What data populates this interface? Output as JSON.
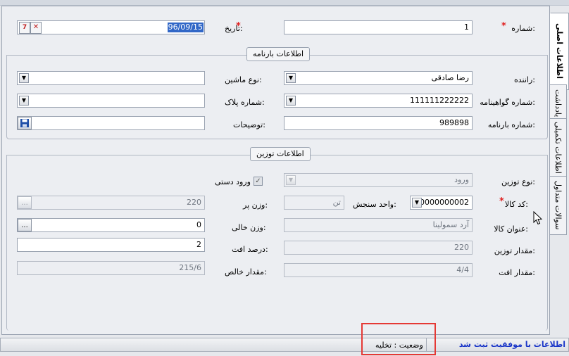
{
  "tabs": [
    {
      "label": "اطلاعات اصلی",
      "active": true
    },
    {
      "label": "یادداشت",
      "active": false
    },
    {
      "label": "اطلاعات تکمیلی",
      "active": false
    },
    {
      "label": "سوالات متداول",
      "active": false
    }
  ],
  "header": {
    "number_label": "شماره:",
    "number_value": "1",
    "date_label": "تاریخ:",
    "date_value": "96/09/15"
  },
  "waybill": {
    "title": "اطلاعات بارنامه",
    "driver_label": "راننده:",
    "driver_value": "رضا صادقی",
    "machine_type_label": "نوع ماشین:",
    "machine_type_value": "",
    "license_label": "شماره گواهینامه:",
    "license_value": "111111222222",
    "plate_label": "شماره پلاک:",
    "plate_value": "",
    "waybill_no_label": "شماره بارنامه:",
    "waybill_no_value": "989898",
    "description_label": "توضیحات:",
    "description_value": ""
  },
  "weighing": {
    "title": "اطلاعات توزین",
    "weigh_type_label": "نوع توزین:",
    "weigh_type_value": "ورود",
    "manual_entry_label": "ورود دستی",
    "goods_code_label": "کد کالا:",
    "goods_code_value": "0000000002",
    "unit_label": "واحد سنجش:",
    "unit_value": "تن",
    "full_weight_label": "وزن پر:",
    "full_weight_value": "220",
    "goods_title_label": "عنوان کالا:",
    "goods_title_value": "آرد سمولینا",
    "empty_weight_label": "وزن خالی:",
    "empty_weight_value": "0",
    "weigh_amount_label": "مقدار توزین:",
    "weigh_amount_value": "220",
    "loss_percent_label": "درصد افت:",
    "loss_percent_value": "2",
    "loss_amount_label": "مقدار افت:",
    "loss_amount_value": "4/4",
    "net_amount_label": "مقدار خالص:",
    "net_amount_value": "215/6"
  },
  "buttons": {
    "ellipsis": "...",
    "dropdown_arrow": "▼"
  },
  "status": {
    "message": "اطلاعات با موفقیت ثبت شد",
    "state_text": "وضعیت : تخلیه"
  },
  "colors": {
    "required": "#e02020",
    "status_message": "#1a36c8",
    "highlight": "#e53935"
  }
}
